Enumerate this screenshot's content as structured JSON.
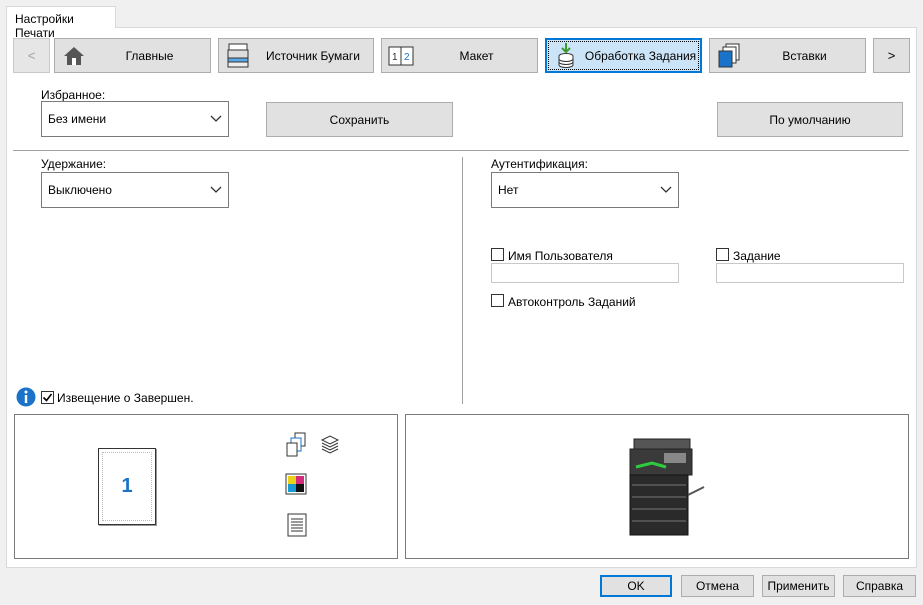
{
  "dialog_tab": "Настройки Печати",
  "nav": {
    "prev_label": "<",
    "next_label": ">",
    "tabs": [
      {
        "label": "Главные",
        "icon": "home-icon"
      },
      {
        "label": "Источник Бумаги",
        "icon": "paper-tray-icon"
      },
      {
        "label": "Макет",
        "icon": "layout-icon"
      },
      {
        "label": "Обработка Задания",
        "icon": "job-stack-icon",
        "active": true
      },
      {
        "label": "Вставки",
        "icon": "inserts-icon"
      }
    ]
  },
  "favorites": {
    "label": "Избранное:",
    "value": "Без имени",
    "save_label": "Сохранить",
    "default_label": "По умолчанию"
  },
  "retention": {
    "label": "Удержание:",
    "value": "Выключено"
  },
  "authentication": {
    "label": "Аутентификация:",
    "value": "Нет",
    "username_label": "Имя Пользователя",
    "username_checked": false,
    "username_value": "",
    "job_label": "Задание",
    "job_checked": false,
    "job_value": "",
    "job_control_label": "Автоконтроль Заданий",
    "job_control_checked": false
  },
  "notification": {
    "label": "Извещение о Завершен.",
    "checked": true
  },
  "preview": {
    "page_number": "1"
  },
  "footer": {
    "ok_label": "OK",
    "cancel_label": "Отмена",
    "apply_label": "Применить",
    "help_label": "Справка"
  },
  "colors": {
    "accent": "#0078d7",
    "active_tab_bg": "#cce4f7"
  }
}
